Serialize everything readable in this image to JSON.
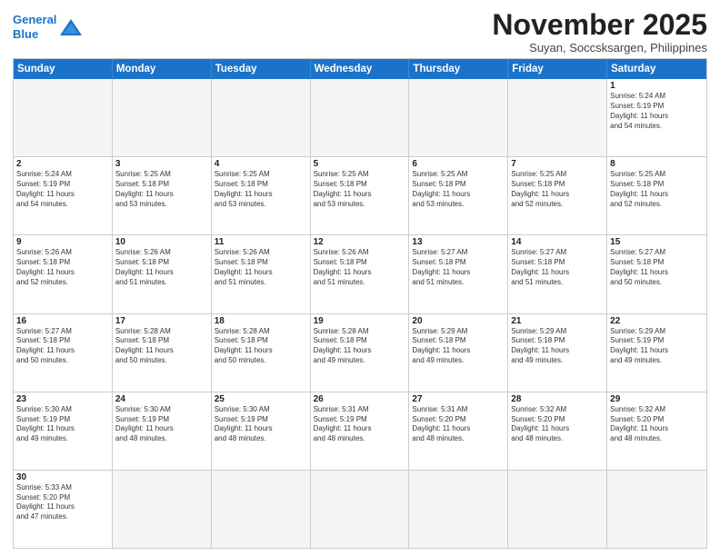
{
  "logo": {
    "line1": "General",
    "line2": "Blue"
  },
  "title": "November 2025",
  "location": "Suyan, Soccsksargen, Philippines",
  "header_days": [
    "Sunday",
    "Monday",
    "Tuesday",
    "Wednesday",
    "Thursday",
    "Friday",
    "Saturday"
  ],
  "weeks": [
    [
      {
        "day": "",
        "empty": true,
        "text": ""
      },
      {
        "day": "",
        "empty": true,
        "text": ""
      },
      {
        "day": "",
        "empty": true,
        "text": ""
      },
      {
        "day": "",
        "empty": true,
        "text": ""
      },
      {
        "day": "",
        "empty": true,
        "text": ""
      },
      {
        "day": "",
        "empty": true,
        "text": ""
      },
      {
        "day": "1",
        "empty": false,
        "text": "Sunrise: 5:24 AM\nSunset: 5:19 PM\nDaylight: 11 hours\nand 54 minutes."
      }
    ],
    [
      {
        "day": "2",
        "empty": false,
        "text": "Sunrise: 5:24 AM\nSunset: 5:19 PM\nDaylight: 11 hours\nand 54 minutes."
      },
      {
        "day": "3",
        "empty": false,
        "text": "Sunrise: 5:25 AM\nSunset: 5:18 PM\nDaylight: 11 hours\nand 53 minutes."
      },
      {
        "day": "4",
        "empty": false,
        "text": "Sunrise: 5:25 AM\nSunset: 5:18 PM\nDaylight: 11 hours\nand 53 minutes."
      },
      {
        "day": "5",
        "empty": false,
        "text": "Sunrise: 5:25 AM\nSunset: 5:18 PM\nDaylight: 11 hours\nand 53 minutes."
      },
      {
        "day": "6",
        "empty": false,
        "text": "Sunrise: 5:25 AM\nSunset: 5:18 PM\nDaylight: 11 hours\nand 53 minutes."
      },
      {
        "day": "7",
        "empty": false,
        "text": "Sunrise: 5:25 AM\nSunset: 5:18 PM\nDaylight: 11 hours\nand 52 minutes."
      },
      {
        "day": "8",
        "empty": false,
        "text": "Sunrise: 5:25 AM\nSunset: 5:18 PM\nDaylight: 11 hours\nand 52 minutes."
      }
    ],
    [
      {
        "day": "9",
        "empty": false,
        "text": "Sunrise: 5:26 AM\nSunset: 5:18 PM\nDaylight: 11 hours\nand 52 minutes."
      },
      {
        "day": "10",
        "empty": false,
        "text": "Sunrise: 5:26 AM\nSunset: 5:18 PM\nDaylight: 11 hours\nand 51 minutes."
      },
      {
        "day": "11",
        "empty": false,
        "text": "Sunrise: 5:26 AM\nSunset: 5:18 PM\nDaylight: 11 hours\nand 51 minutes."
      },
      {
        "day": "12",
        "empty": false,
        "text": "Sunrise: 5:26 AM\nSunset: 5:18 PM\nDaylight: 11 hours\nand 51 minutes."
      },
      {
        "day": "13",
        "empty": false,
        "text": "Sunrise: 5:27 AM\nSunset: 5:18 PM\nDaylight: 11 hours\nand 51 minutes."
      },
      {
        "day": "14",
        "empty": false,
        "text": "Sunrise: 5:27 AM\nSunset: 5:18 PM\nDaylight: 11 hours\nand 51 minutes."
      },
      {
        "day": "15",
        "empty": false,
        "text": "Sunrise: 5:27 AM\nSunset: 5:18 PM\nDaylight: 11 hours\nand 50 minutes."
      }
    ],
    [
      {
        "day": "16",
        "empty": false,
        "text": "Sunrise: 5:27 AM\nSunset: 5:18 PM\nDaylight: 11 hours\nand 50 minutes."
      },
      {
        "day": "17",
        "empty": false,
        "text": "Sunrise: 5:28 AM\nSunset: 5:18 PM\nDaylight: 11 hours\nand 50 minutes."
      },
      {
        "day": "18",
        "empty": false,
        "text": "Sunrise: 5:28 AM\nSunset: 5:18 PM\nDaylight: 11 hours\nand 50 minutes."
      },
      {
        "day": "19",
        "empty": false,
        "text": "Sunrise: 5:28 AM\nSunset: 5:18 PM\nDaylight: 11 hours\nand 49 minutes."
      },
      {
        "day": "20",
        "empty": false,
        "text": "Sunrise: 5:29 AM\nSunset: 5:18 PM\nDaylight: 11 hours\nand 49 minutes."
      },
      {
        "day": "21",
        "empty": false,
        "text": "Sunrise: 5:29 AM\nSunset: 5:18 PM\nDaylight: 11 hours\nand 49 minutes."
      },
      {
        "day": "22",
        "empty": false,
        "text": "Sunrise: 5:29 AM\nSunset: 5:19 PM\nDaylight: 11 hours\nand 49 minutes."
      }
    ],
    [
      {
        "day": "23",
        "empty": false,
        "text": "Sunrise: 5:30 AM\nSunset: 5:19 PM\nDaylight: 11 hours\nand 49 minutes."
      },
      {
        "day": "24",
        "empty": false,
        "text": "Sunrise: 5:30 AM\nSunset: 5:19 PM\nDaylight: 11 hours\nand 48 minutes."
      },
      {
        "day": "25",
        "empty": false,
        "text": "Sunrise: 5:30 AM\nSunset: 5:19 PM\nDaylight: 11 hours\nand 48 minutes."
      },
      {
        "day": "26",
        "empty": false,
        "text": "Sunrise: 5:31 AM\nSunset: 5:19 PM\nDaylight: 11 hours\nand 48 minutes."
      },
      {
        "day": "27",
        "empty": false,
        "text": "Sunrise: 5:31 AM\nSunset: 5:20 PM\nDaylight: 11 hours\nand 48 minutes."
      },
      {
        "day": "28",
        "empty": false,
        "text": "Sunrise: 5:32 AM\nSunset: 5:20 PM\nDaylight: 11 hours\nand 48 minutes."
      },
      {
        "day": "29",
        "empty": false,
        "text": "Sunrise: 5:32 AM\nSunset: 5:20 PM\nDaylight: 11 hours\nand 48 minutes."
      }
    ],
    [
      {
        "day": "30",
        "empty": false,
        "text": "Sunrise: 5:33 AM\nSunset: 5:20 PM\nDaylight: 11 hours\nand 47 minutes."
      },
      {
        "day": "",
        "empty": true,
        "text": ""
      },
      {
        "day": "",
        "empty": true,
        "text": ""
      },
      {
        "day": "",
        "empty": true,
        "text": ""
      },
      {
        "day": "",
        "empty": true,
        "text": ""
      },
      {
        "day": "",
        "empty": true,
        "text": ""
      },
      {
        "day": "",
        "empty": true,
        "text": ""
      }
    ]
  ]
}
